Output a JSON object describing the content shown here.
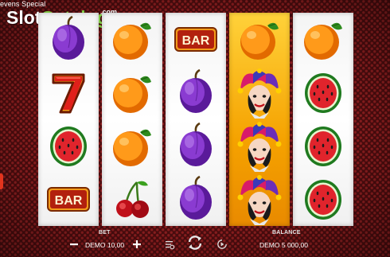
{
  "game": {
    "title": "evens Special"
  },
  "watermark": {
    "part1": "Slot",
    "part2": "Catalog",
    "suffix": ".com"
  },
  "reels": [
    [
      "plum",
      "seven",
      "watermelon",
      "bar"
    ],
    [
      "orange",
      "orange",
      "orange",
      "cherries"
    ],
    [
      "bar",
      "plum",
      "plum",
      "plum"
    ],
    [
      "orange",
      "joker",
      "joker",
      "joker"
    ],
    [
      "orange",
      "watermelon",
      "watermelon",
      "watermelon"
    ]
  ],
  "symbol_text": {
    "bar": "BAR"
  },
  "bottom_bar": {
    "bet_label": "BET",
    "bet_value": "DEMO 10,00",
    "balance_label": "BALANCE",
    "balance_value": "DEMO 5 000,00"
  },
  "icons": {
    "minus": "minus-icon",
    "plus": "plus-icon",
    "settings": "settings-sliders-icon",
    "spin": "spin-arrows-icon",
    "autoplay": "autoplay-icon"
  },
  "colors": {
    "background": "#4a0c0e",
    "reel": "#ffffff",
    "highlight_reel": "#f5a200",
    "watermark_accent": "#7ec843"
  }
}
